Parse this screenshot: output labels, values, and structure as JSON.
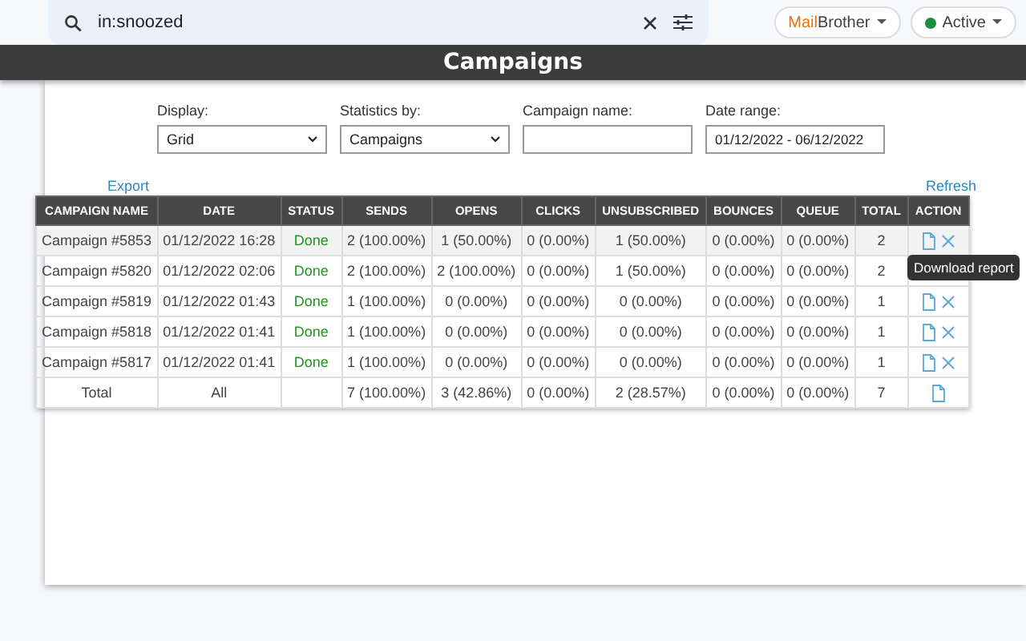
{
  "search": {
    "value": "in:snoozed"
  },
  "brand": {
    "first": "Mail",
    "second": "Brother"
  },
  "status_chip": {
    "label": "Active",
    "color": "#1e8e3e"
  },
  "header": {
    "title": "Campaigns"
  },
  "filters": [
    {
      "label": "Display:",
      "kind": "select",
      "value": "Grid"
    },
    {
      "label": "Statistics by:",
      "kind": "select",
      "value": "Campaigns"
    },
    {
      "label": "Campaign name:",
      "kind": "input"
    },
    {
      "label": "Date range:",
      "kind": "input",
      "value": "01/12/2022 - 06/12/2022"
    }
  ],
  "links": {
    "export": "Export",
    "refresh": "Refresh"
  },
  "table": {
    "columns": [
      "CAMPAIGN NAME",
      "DATE",
      "STATUS",
      "SENDS",
      "OPENS",
      "CLICKS",
      "UNSUBSCRIBED",
      "BOUNCES",
      "QUEUE",
      "TOTAL",
      "ACTION"
    ],
    "rows": [
      {
        "cells": [
          "Campaign #5853",
          "01/12/2022 16:28",
          "Done",
          "2 (100.00%)",
          "1 (50.00%)",
          "0 (0.00%)",
          "1 (50.00%)",
          "0 (0.00%)",
          "0 (0.00%)",
          "2"
        ],
        "actions": {
          "download": true,
          "delete": true
        },
        "hovered": true
      },
      {
        "cells": [
          "Campaign #5820",
          "01/12/2022 02:06",
          "Done",
          "2 (100.00%)",
          "2 (100.00%)",
          "0 (0.00%)",
          "1 (50.00%)",
          "0 (0.00%)",
          "0 (0.00%)",
          "2"
        ],
        "actions": {
          "download": false,
          "delete": false
        },
        "hovered": false
      },
      {
        "cells": [
          "Campaign #5819",
          "01/12/2022 01:43",
          "Done",
          "1 (100.00%)",
          "0 (0.00%)",
          "0 (0.00%)",
          "0 (0.00%)",
          "0 (0.00%)",
          "0 (0.00%)",
          "1"
        ],
        "actions": {
          "download": true,
          "delete": true
        },
        "hovered": false
      },
      {
        "cells": [
          "Campaign #5818",
          "01/12/2022 01:41",
          "Done",
          "1 (100.00%)",
          "0 (0.00%)",
          "0 (0.00%)",
          "0 (0.00%)",
          "0 (0.00%)",
          "0 (0.00%)",
          "1"
        ],
        "actions": {
          "download": true,
          "delete": true
        },
        "hovered": false
      },
      {
        "cells": [
          "Campaign #5817",
          "01/12/2022 01:41",
          "Done",
          "1 (100.00%)",
          "0 (0.00%)",
          "0 (0.00%)",
          "0 (0.00%)",
          "0 (0.00%)",
          "0 (0.00%)",
          "1"
        ],
        "actions": {
          "download": true,
          "delete": true
        },
        "hovered": false
      }
    ],
    "total": {
      "cells": [
        "Total",
        "All",
        "",
        "7 (100.00%)",
        "3 (42.86%)",
        "0 (0.00%)",
        "2 (28.57%)",
        "0 (0.00%)",
        "0 (0.00%)",
        "7"
      ],
      "actions": {
        "download": true,
        "delete": false
      }
    }
  },
  "tooltip": {
    "text": "Download report"
  }
}
